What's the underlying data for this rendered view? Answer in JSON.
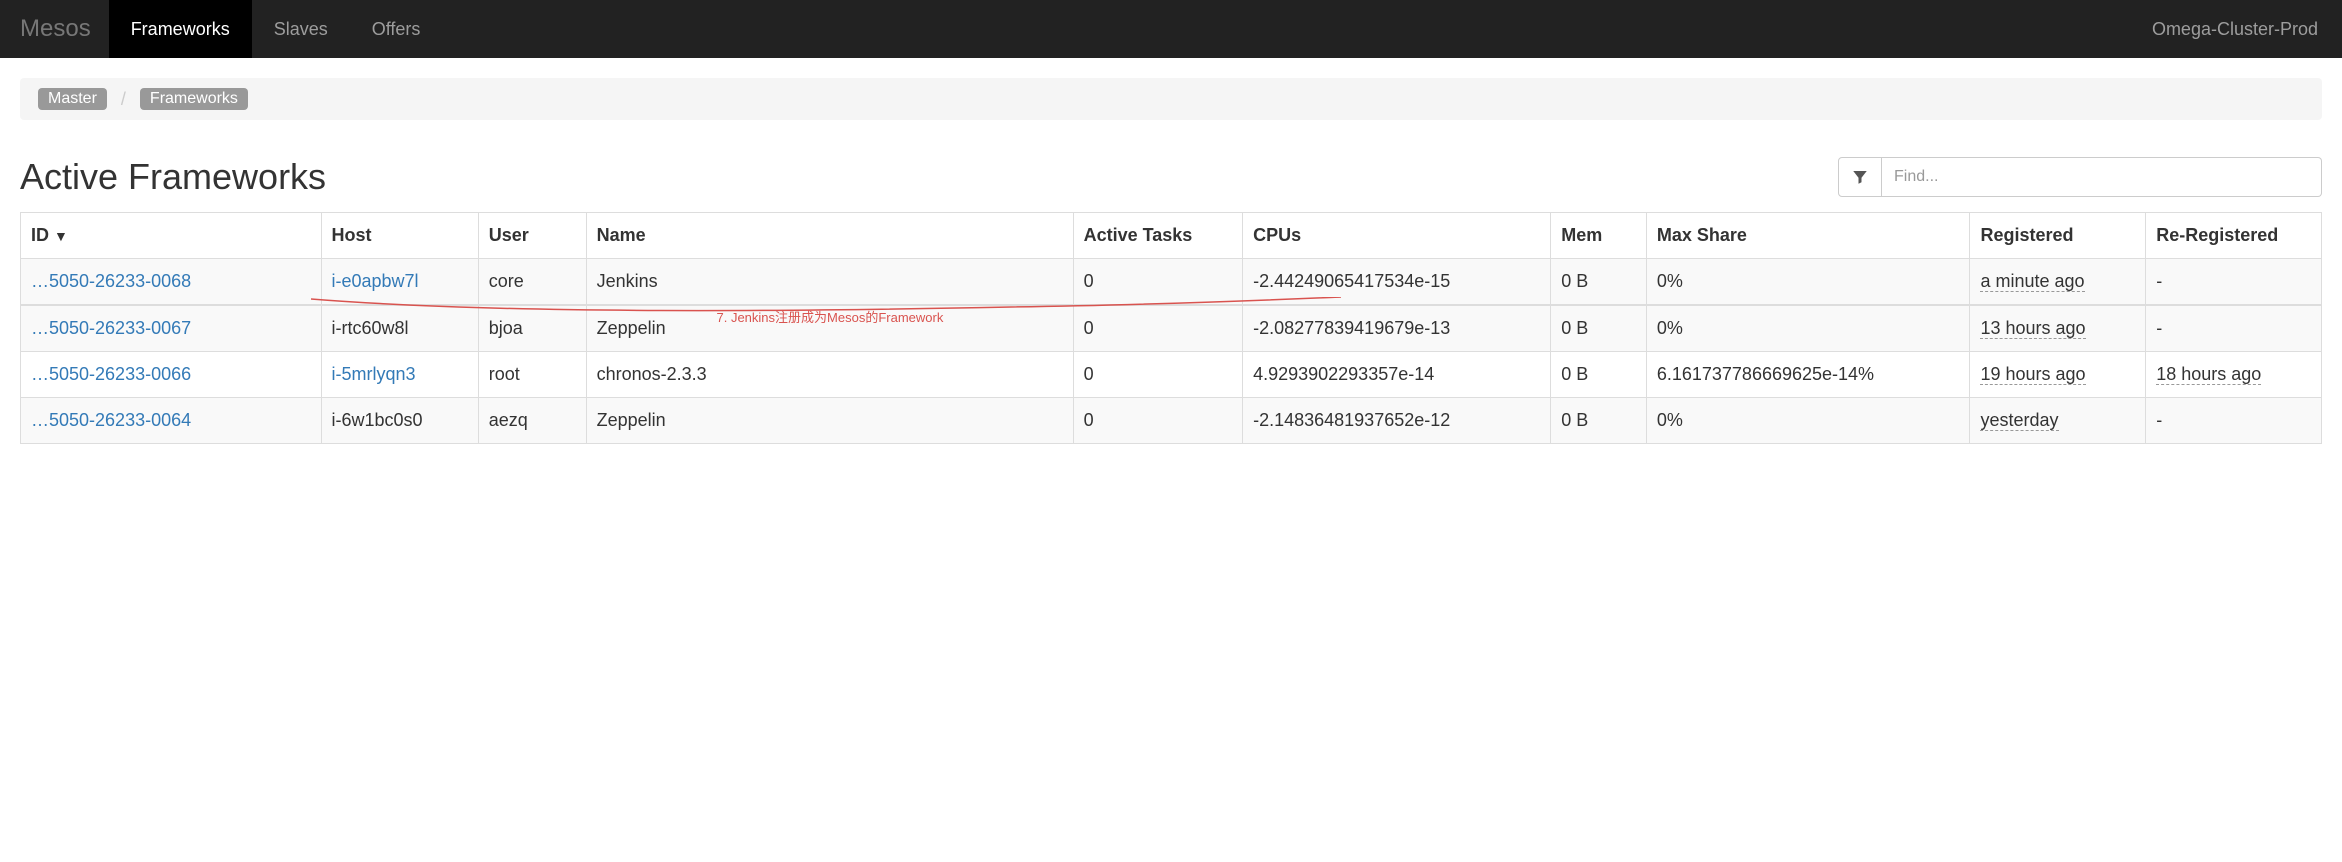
{
  "nav": {
    "brand": "Mesos",
    "items": [
      "Frameworks",
      "Slaves",
      "Offers"
    ],
    "active_index": 0,
    "cluster_name": "Omega-Cluster-Prod"
  },
  "breadcrumb": {
    "items": [
      "Master",
      "Frameworks"
    ]
  },
  "section_title": "Active Frameworks",
  "search": {
    "placeholder": "Find..."
  },
  "table": {
    "headers": {
      "id": "ID",
      "sort_indicator": "▼",
      "host": "Host",
      "user": "User",
      "name": "Name",
      "active_tasks": "Active Tasks",
      "cpus": "CPUs",
      "mem": "Mem",
      "max_share": "Max Share",
      "registered": "Registered",
      "re_registered": "Re-Registered"
    },
    "rows": [
      {
        "id": "…5050-26233-0068",
        "host": "i-e0apbw7l",
        "host_link": true,
        "user": "core",
        "name": "Jenkins",
        "active_tasks": "0",
        "cpus": "-2.44249065417534e-15",
        "mem": "0 B",
        "max_share": "0%",
        "registered": "a minute ago",
        "re_registered": "-"
      },
      {
        "id": "…5050-26233-0067",
        "host": "i-rtc60w8l",
        "host_link": false,
        "user": "bjoa",
        "name": "Zeppelin",
        "active_tasks": "0",
        "cpus": "-2.08277839419679e-13",
        "mem": "0 B",
        "max_share": "0%",
        "registered": "13 hours ago",
        "re_registered": "-"
      },
      {
        "id": "…5050-26233-0066",
        "host": "i-5mrlyqn3",
        "host_link": true,
        "user": "root",
        "name": "chronos-2.3.3",
        "active_tasks": "0",
        "cpus": "4.9293902293357e-14",
        "mem": "0 B",
        "max_share": "6.161737786669625e-14%",
        "registered": "19 hours ago",
        "re_registered": "18 hours ago"
      },
      {
        "id": "…5050-26233-0064",
        "host": "i-6w1bc0s0",
        "host_link": false,
        "user": "aezq",
        "name": "Zeppelin",
        "active_tasks": "0",
        "cpus": "-2.14836481937652e-12",
        "mem": "0 B",
        "max_share": "0%",
        "registered": "yesterday",
        "re_registered": "-"
      }
    ]
  },
  "annotation": {
    "text": "7. Jenkins注册成为Mesos的Framework"
  }
}
